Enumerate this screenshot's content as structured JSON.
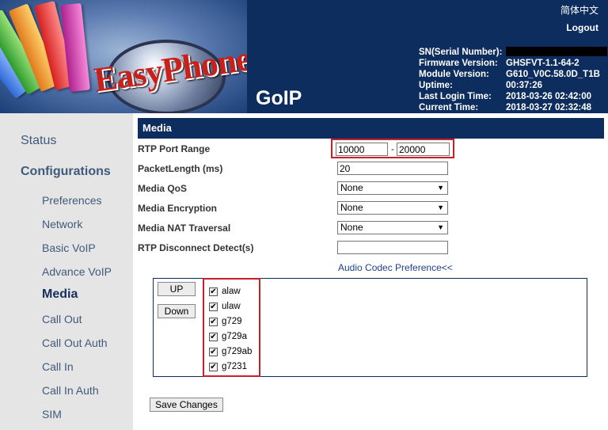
{
  "header": {
    "product_name": "GoIP",
    "logo_text": "EasyPhone",
    "language_link": "简体中文",
    "logout": "Logout",
    "info": [
      {
        "label": "SN(Serial Number):",
        "value": ""
      },
      {
        "label": "Firmware Version:",
        "value": "GHSFVT-1.1-64-2"
      },
      {
        "label": "Module Version:",
        "value": "G610_V0C.58.0D_T1B"
      },
      {
        "label": "Uptime:",
        "value": "00:37:26"
      },
      {
        "label": "Last Login Time:",
        "value": "2018-03-26 02:42:00"
      },
      {
        "label": "Current Time:",
        "value": "2018-03-27 02:32:48"
      }
    ]
  },
  "sidebar": {
    "status": "Status",
    "configurations": "Configurations",
    "items": [
      "Preferences",
      "Network",
      "Basic VoIP",
      "Advance VoIP",
      "Media",
      "Call Out",
      "Call Out Auth",
      "Call In",
      "Call In Auth",
      "SIM"
    ],
    "active": "Media"
  },
  "main": {
    "section_title": "Media",
    "rtp_port_range": {
      "label": "RTP Port Range",
      "from": "10000",
      "separator": "-",
      "to": "20000"
    },
    "packet_length": {
      "label": "PacketLength (ms)",
      "value": "20"
    },
    "media_qos": {
      "label": "Media QoS",
      "value": "None"
    },
    "media_encryption": {
      "label": "Media Encryption",
      "value": "None"
    },
    "media_nat_traversal": {
      "label": "Media NAT Traversal",
      "value": "None"
    },
    "rtp_disconnect_detect": {
      "label": "RTP Disconnect Detect(s)",
      "value": ""
    },
    "codec_preference_link": "Audio Codec Preference<<",
    "up_button": "UP",
    "down_button": "Down",
    "codecs": [
      {
        "name": "alaw",
        "checked": true
      },
      {
        "name": "ulaw",
        "checked": true
      },
      {
        "name": "g729",
        "checked": true
      },
      {
        "name": "g729a",
        "checked": true
      },
      {
        "name": "g729ab",
        "checked": true
      },
      {
        "name": "g7231",
        "checked": true
      }
    ],
    "save_button": "Save Changes"
  },
  "colors": {
    "header_bg": "#0d2d5e",
    "sidebar_bg": "#e5e5e5",
    "highlight": "#c8202a",
    "link": "#1f3f8f"
  }
}
